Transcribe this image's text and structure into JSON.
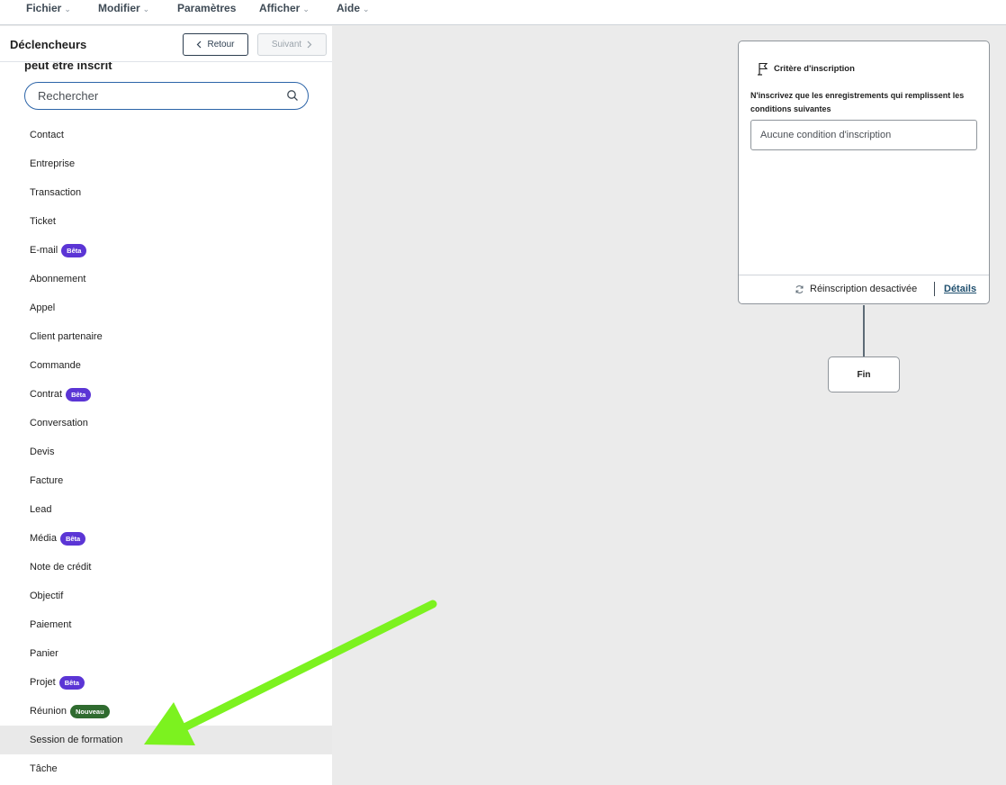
{
  "menu": [
    {
      "label": "Fichier",
      "has_dropdown": true
    },
    {
      "label": "Modifier",
      "has_dropdown": true
    },
    {
      "label": "Paramètres",
      "has_dropdown": false
    },
    {
      "label": "Afficher",
      "has_dropdown": true
    },
    {
      "label": "Aide",
      "has_dropdown": true
    }
  ],
  "sidebar": {
    "title": "Déclencheurs",
    "back_label": "Retour",
    "next_label": "Suivant",
    "clipped_heading": "peut être inscrit",
    "search_placeholder": "Rechercher",
    "items": [
      {
        "label": "Contact",
        "badge": null
      },
      {
        "label": "Entreprise",
        "badge": null
      },
      {
        "label": "Transaction",
        "badge": null
      },
      {
        "label": "Ticket",
        "badge": null
      },
      {
        "label": "E-mail",
        "badge": "Bêta"
      },
      {
        "label": "Abonnement",
        "badge": null
      },
      {
        "label": "Appel",
        "badge": null
      },
      {
        "label": "Client partenaire",
        "badge": null
      },
      {
        "label": "Commande",
        "badge": null
      },
      {
        "label": "Contrat",
        "badge": "Bêta"
      },
      {
        "label": "Conversation",
        "badge": null
      },
      {
        "label": "Devis",
        "badge": null
      },
      {
        "label": "Facture",
        "badge": null
      },
      {
        "label": "Lead",
        "badge": null
      },
      {
        "label": "Média",
        "badge": "Bêta"
      },
      {
        "label": "Note de crédit",
        "badge": null
      },
      {
        "label": "Objectif",
        "badge": null
      },
      {
        "label": "Paiement",
        "badge": null
      },
      {
        "label": "Panier",
        "badge": null
      },
      {
        "label": "Projet",
        "badge": "Bêta"
      },
      {
        "label": "Réunion",
        "badge": "Nouveau"
      },
      {
        "label": "Session de formation",
        "badge": null,
        "selected": true
      },
      {
        "label": "Tâche",
        "badge": null
      }
    ]
  },
  "badge_colors": {
    "Bêta": "#5b35d5",
    "Nouveau": "#2f6b2f"
  },
  "enrollment_card": {
    "title": "Critère d'inscription",
    "description": "N'inscrivez que les enregistrements qui remplissent les conditions suivantes",
    "condition_placeholder": "Aucune condition d'inscription",
    "reenrollment_status": "Réinscription desactivée",
    "details_link": "Détails"
  },
  "end_node": {
    "label": "Fin"
  },
  "annotation": {
    "arrow_color": "#7cf21f",
    "points_to": "Session de formation"
  }
}
